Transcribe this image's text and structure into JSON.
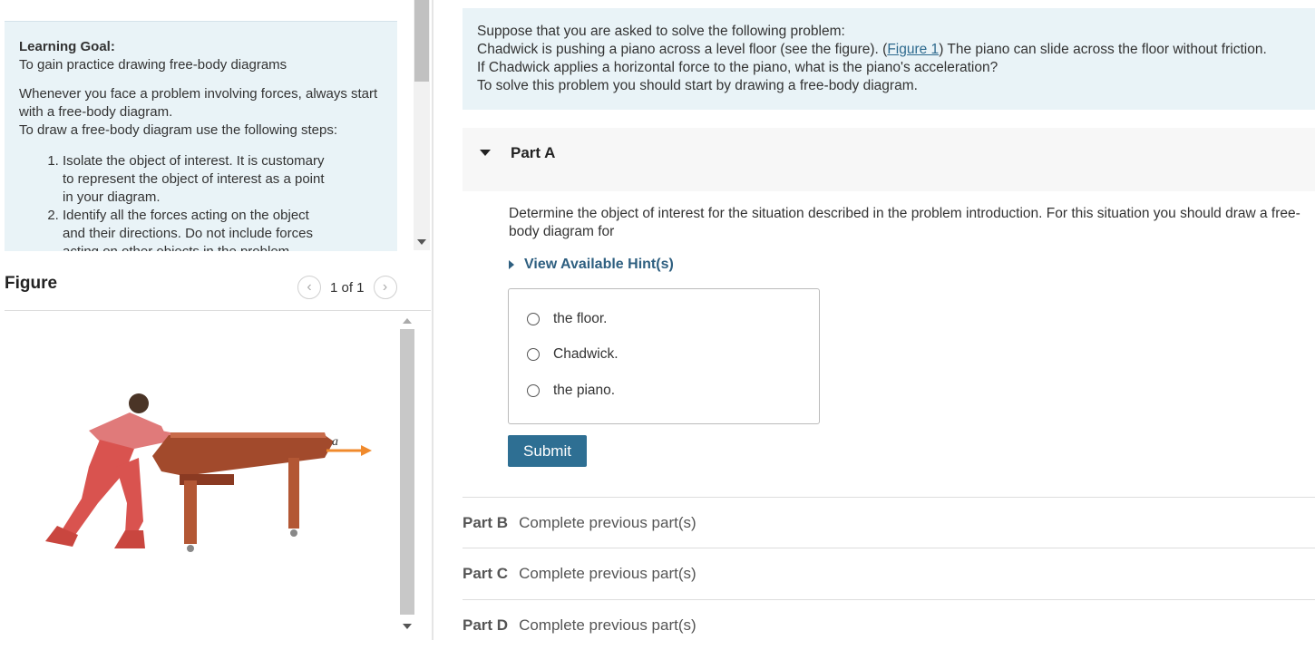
{
  "learning_goal": {
    "title": "Learning Goal:",
    "subtitle": "To gain practice drawing free-body diagrams",
    "para1": "Whenever you face a problem involving forces, always start with a free-body diagram.",
    "para2": "To draw a free-body diagram use the following steps:",
    "steps": [
      "Isolate the object of interest. It is customary to represent the object of interest as a point in your diagram.",
      "Identify all the forces acting on the object and their directions. Do not include forces acting on other objects in the problem."
    ]
  },
  "figure": {
    "title": "Figure",
    "counter": "1 of 1",
    "vector_label": "a⃗"
  },
  "intro": {
    "line1": "Suppose that you are asked to solve the following problem:",
    "line2_before": "Chadwick is pushing a piano across a level floor (see the figure). (",
    "line2_link": "Figure 1",
    "line2_after": ") The piano can slide across the floor without friction.",
    "line3": "If Chadwick applies a horizontal force to the piano, what is the piano's acceleration?",
    "line4": "To solve this problem you should start by drawing a free-body diagram."
  },
  "partA": {
    "title": "Part A",
    "question": "Determine the object of interest for the situation described in the problem introduction. For this situation you should draw a free-body diagram for",
    "hints_label": "View Available Hint(s)",
    "options": [
      "the floor.",
      "Chadwick.",
      "the piano."
    ],
    "submit_label": "Submit"
  },
  "parts": [
    {
      "label": "Part B",
      "status": "Complete previous part(s)"
    },
    {
      "label": "Part C",
      "status": "Complete previous part(s)"
    },
    {
      "label": "Part D",
      "status": "Complete previous part(s)"
    }
  ],
  "colors": {
    "panel_bg": "#e9f3f7",
    "accent": "#2e6f93",
    "arrow": "#f08a2c",
    "piano": "#a24a2c",
    "shirt": "#e07a7a"
  }
}
